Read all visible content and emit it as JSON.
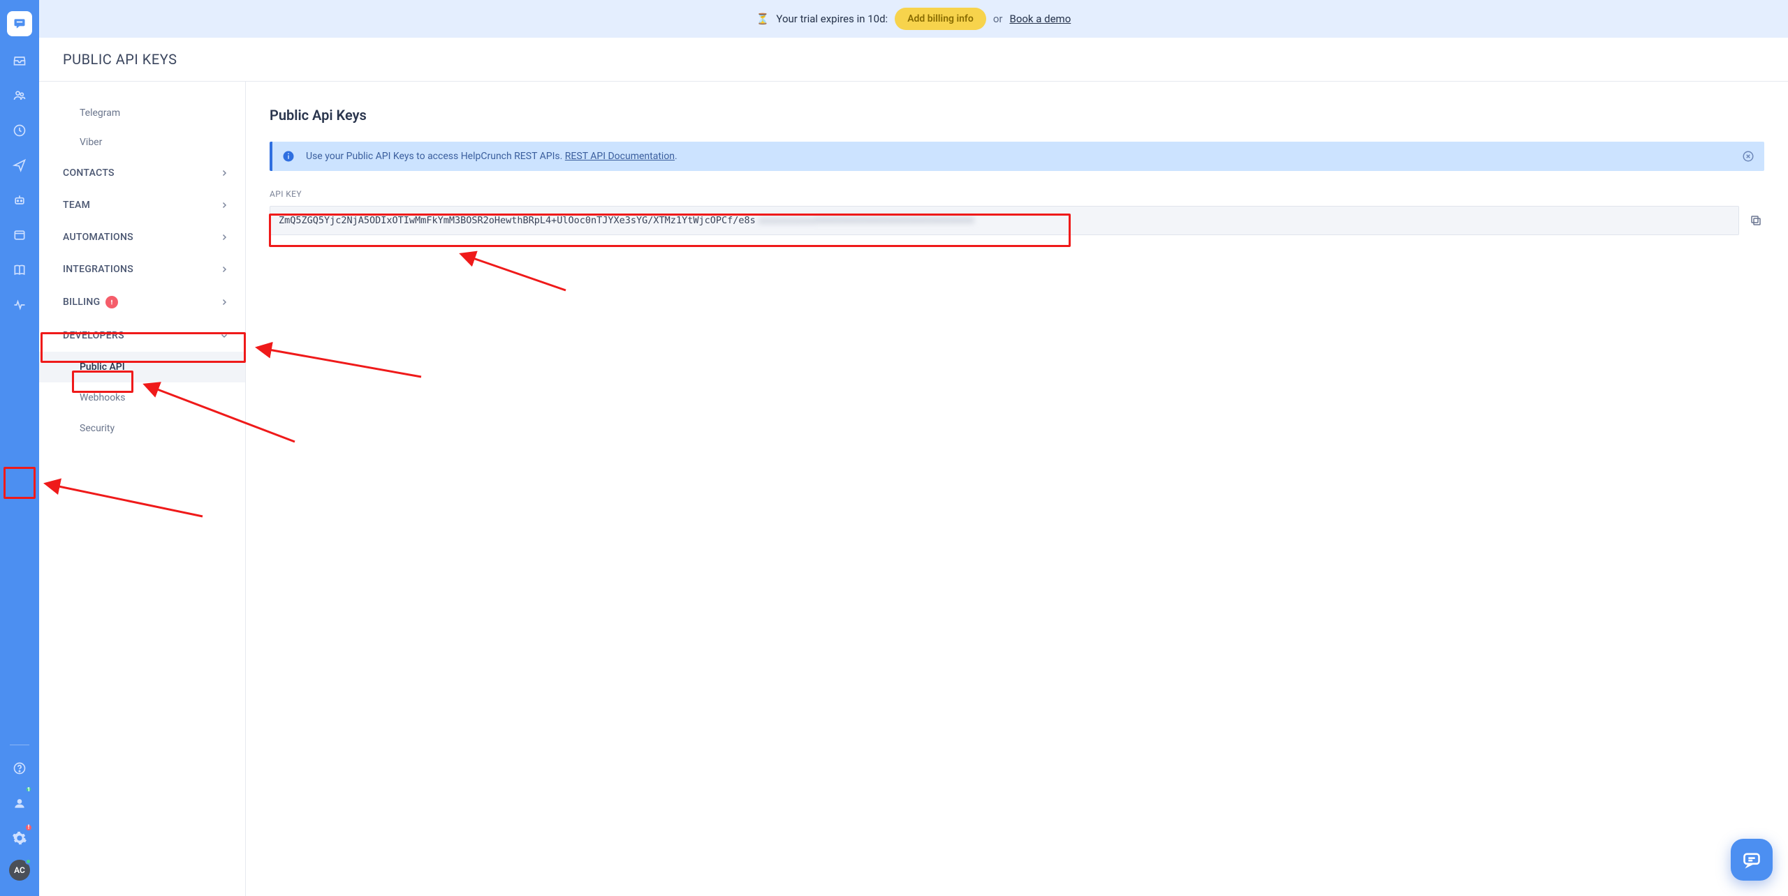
{
  "trial": {
    "hourglass": "⏳",
    "text": "Your trial expires in 10d:",
    "cta": "Add billing info",
    "or": "or",
    "demo": "Book a demo"
  },
  "pageTitle": "PUBLIC API KEYS",
  "rail": {
    "avatar": "AC"
  },
  "settings": {
    "subsubs": [
      "Telegram",
      "Viber"
    ],
    "cats": [
      {
        "label": "CONTACTS"
      },
      {
        "label": "TEAM"
      },
      {
        "label": "AUTOMATIONS"
      },
      {
        "label": "INTEGRATIONS"
      },
      {
        "label": "BILLING",
        "badge": "!"
      }
    ],
    "developers": {
      "label": "DEVELOPERS",
      "items": [
        "Public API",
        "Webhooks",
        "Security"
      ],
      "active": 0
    },
    "users_badge": "1"
  },
  "content": {
    "heading": "Public Api Keys",
    "info_prefix": "Use your Public API Keys to access HelpCrunch REST APIs. ",
    "info_link": "REST API Documentation",
    "info_suffix": ".",
    "field_label": "API KEY",
    "key_visible": "ZmQ5ZGQ5Yjc2NjA5ODIxOTIwMmFkYmM3BOSR2oHewthBRpL4+UlOoc0nTJYXe3sYG/XTMz1YtWjcOPCf/e8s",
    "key_blurred": "aaaaaaaaaaAAAAAAAAAAAAAAAAAAAAAAAAAAAA"
  }
}
